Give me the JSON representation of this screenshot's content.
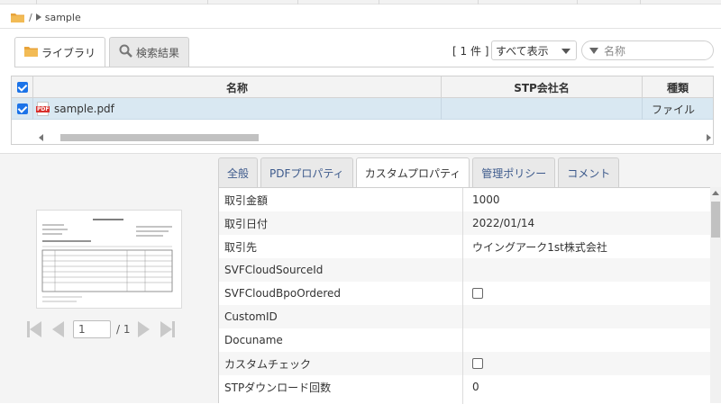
{
  "breadcrumb": {
    "separator": "/",
    "current": "sample"
  },
  "library_tabs": [
    {
      "label": "ライブラリ",
      "icon": "folder-icon",
      "active": true
    },
    {
      "label": "検索結果",
      "icon": "search-icon",
      "active": false
    }
  ],
  "toolbar": {
    "count": "[ 1 件 ]",
    "filter_selected": "すべて表示",
    "search_placeholder": "名称"
  },
  "grid": {
    "columns": [
      "名称",
      "STP会社名",
      "種類"
    ],
    "rows": [
      {
        "name": "sample.pdf",
        "company": "",
        "type": "ファイル",
        "checked": true
      }
    ]
  },
  "pager": {
    "current_page": "1",
    "total": "/ 1"
  },
  "prop_tabs": [
    {
      "label": "全般",
      "active": false
    },
    {
      "label": "PDFプロパティ",
      "active": false
    },
    {
      "label": "カスタムプロパティ",
      "active": true
    },
    {
      "label": "管理ポリシー",
      "active": false
    },
    {
      "label": "コメント",
      "active": false
    }
  ],
  "properties": [
    {
      "key": "取引金額",
      "value": "1000"
    },
    {
      "key": "取引日付",
      "value": "2022/01/14"
    },
    {
      "key": "取引先",
      "value": "ウイングアーク1st株式会社"
    },
    {
      "key": "SVFCloudSourceId",
      "value": ""
    },
    {
      "key": "SVFCloudBpoOrdered",
      "value": "",
      "checkbox": true
    },
    {
      "key": "CustomID",
      "value": ""
    },
    {
      "key": "Docuname",
      "value": ""
    },
    {
      "key": "カスタムチェック",
      "value": "",
      "checkbox": true
    },
    {
      "key": "STPダウンロード回数",
      "value": "0"
    }
  ],
  "colors": {
    "accent": "#1b73e8",
    "row_selected": "#d9e8f2",
    "folder": "#e8a33a",
    "pdf_badge": "#d9302c"
  }
}
